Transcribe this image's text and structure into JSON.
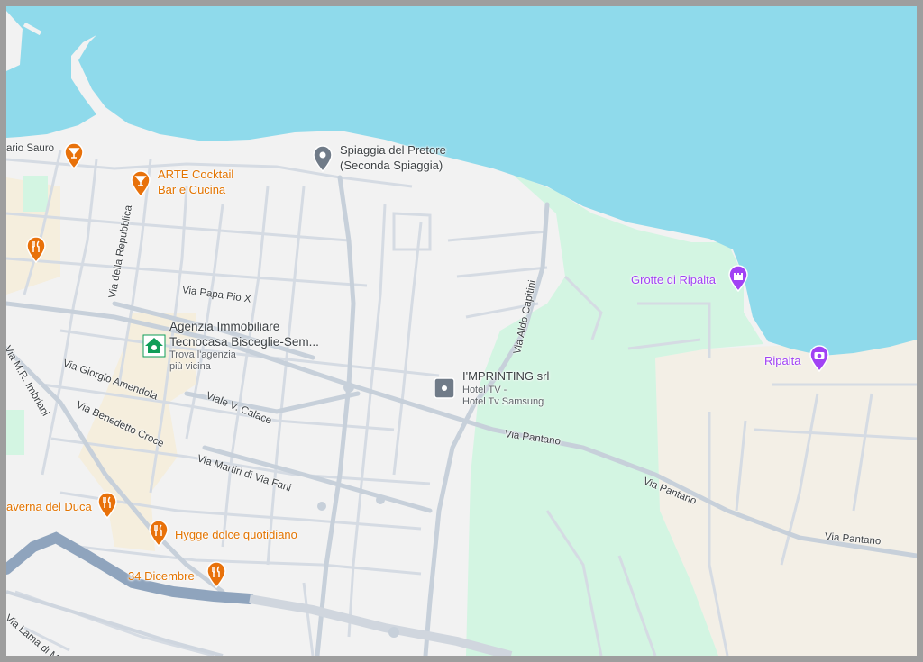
{
  "colors": {
    "sea": "#8fdaeb",
    "land": "#f2f2f2",
    "park": "#d3f5e2",
    "sand": "#f3efe6",
    "oldtown": "#f5eedd",
    "road": "#cfd6df",
    "highway": "#8fa4bd",
    "food_poi": "#e8710a",
    "attraction_poi": "#a142f4",
    "business_poi": "#707b88",
    "agency_poi": "#0f9d58"
  },
  "places": {
    "spiaggia": {
      "name": "Spiaggia del Pretore",
      "subname": "(Seconda Spiaggia)",
      "icon": "beach-pin-icon"
    },
    "arte": {
      "line1": "ARTE Cocktail",
      "line2": "Bar e Cucina",
      "icon": "cocktail-icon"
    },
    "grotte": {
      "name": "Grotte di Ripalta",
      "icon": "castle-icon"
    },
    "ripalta": {
      "name": "Ripalta",
      "icon": "camera-icon"
    },
    "agenzia": {
      "line1": "Agenzia Immobiliare",
      "line2": "Tecnocasa Bisceglie-Sem...",
      "sub1": "Trova l'agenzia",
      "sub2": "più vicina",
      "icon": "home-icon"
    },
    "imprinting": {
      "name": "I'MPRINTING srl",
      "sub1": "Hotel TV -",
      "sub2": "Hotel Tv Samsung",
      "icon": "business-icon"
    },
    "taverna": {
      "name": "averna del Duca",
      "icon": "restaurant-icon"
    },
    "hygge": {
      "name": "Hygge dolce quotidiano",
      "icon": "restaurant-icon"
    },
    "dicembre": {
      "name": "34 Dicembre",
      "icon": "restaurant-icon"
    },
    "restaurant_left": {
      "icon": "restaurant-icon"
    },
    "cocktail_left": {
      "icon": "cocktail-icon"
    }
  },
  "streets": {
    "sauro": "ario Sauro",
    "repubblica": "Via della Repubblica",
    "papa": "Via Papa Pio X",
    "imbriani": "Via M.R. Imbriani",
    "amendola": "Via Giorgio Amendola",
    "calace": "Viale V. Calace",
    "croce": "Via Benedetto Croce",
    "fani": "Via Martiri di Via Fani",
    "capitini": "Via Aldo Capitini",
    "pantano1": "Via Pantano",
    "pantano2": "Via Pantano",
    "pantano3": "Via Pantano",
    "lama": "Via Lama di Me"
  }
}
